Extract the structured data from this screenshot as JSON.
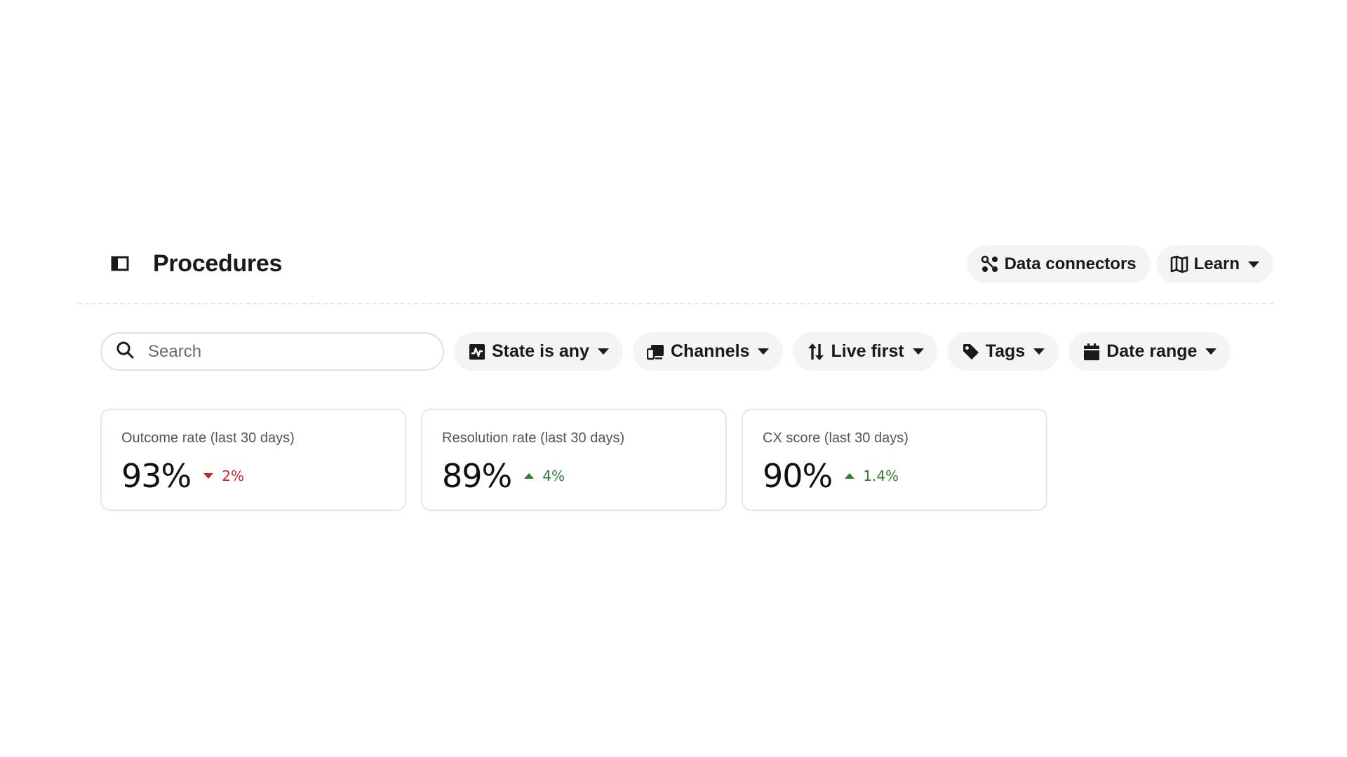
{
  "header": {
    "title": "Procedures",
    "actions": {
      "data_connectors": "Data connectors",
      "learn": "Learn"
    }
  },
  "filters": {
    "search_placeholder": "Search",
    "search_value": "",
    "state": "State is any",
    "channels": "Channels",
    "sort": "Live first",
    "tags": "Tags",
    "date_range": "Date range"
  },
  "metrics": [
    {
      "label": "Outcome rate (last 30 days)",
      "value": "93%",
      "delta": "2%",
      "direction": "down"
    },
    {
      "label": "Resolution rate (last 30 days)",
      "value": "89%",
      "delta": "4%",
      "direction": "up"
    },
    {
      "label": "CX score (last 30 days)",
      "value": "90%",
      "delta": "1.4%",
      "direction": "up"
    }
  ],
  "colors": {
    "delta_down": "#c62828",
    "delta_up": "#2e7d32",
    "pill_bg": "#f4f4f3"
  }
}
